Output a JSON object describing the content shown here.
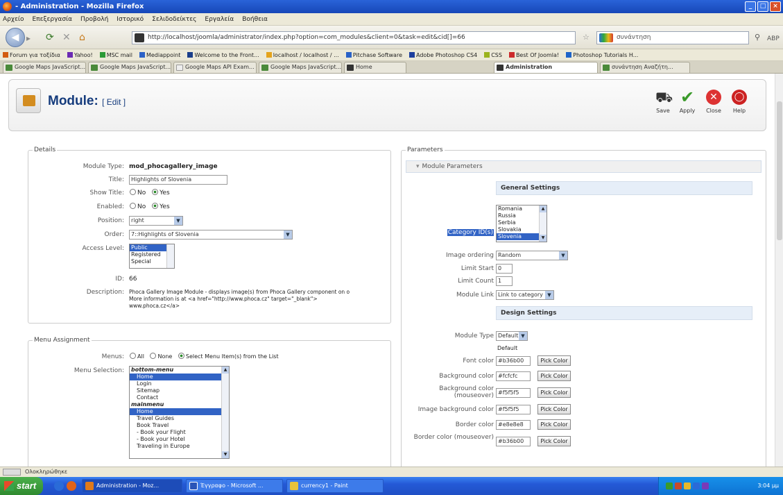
{
  "window": {
    "title": "- Administration - Mozilla Firefox"
  },
  "menubar": [
    "Αρχείο",
    "Επεξεργασία",
    "Προβολή",
    "Ιστορικό",
    "Σελιδοδείκτες",
    "Εργαλεία",
    "Βοήθεια"
  ],
  "nav": {
    "url": "http://localhost/joomla/administrator/index.php?option=com_modules&client=0&task=edit&cid[]=66",
    "search_placeholder": "συνάντηση"
  },
  "bookmarks": [
    "Forum για τοξίδια",
    "Yahoo!",
    "MSC mail",
    "Mediappoint",
    "Welcome to the Front...",
    "localhost / localhost / ...",
    "Pitchase Software",
    "Adobe Photoshop CS4",
    "CSS",
    "Best Of Joomla!",
    "Photoshop Tutorials H..."
  ],
  "tabs": [
    "Google Maps JavaScript...",
    "Google Maps JavaScript...",
    "Google Maps API Exam...",
    "Google Maps JavaScript...",
    "Home",
    "Administration",
    "συνάντηση Αναζήτη..."
  ],
  "page": {
    "title": "Module:",
    "subtitle": "[ Edit ]",
    "toolbar": {
      "save": "Save",
      "apply": "Apply",
      "close": "Close",
      "help": "Help"
    }
  },
  "details": {
    "legend": "Details",
    "module_type_label": "Module Type:",
    "module_type": "mod_phocagallery_image",
    "title_label": "Title:",
    "title_value": "Highlights of Slovenia",
    "show_title_label": "Show Title:",
    "no": "No",
    "yes": "Yes",
    "enabled_label": "Enabled:",
    "position_label": "Position:",
    "position_value": "right",
    "order_label": "Order:",
    "order_value": "7::Highlights of Slovenia",
    "access_label": "Access Level:",
    "access_options": [
      "Public",
      "Registered",
      "Special"
    ],
    "id_label": "ID:",
    "id_value": "66",
    "description_label": "Description:",
    "description_line1": "Phoca Gallery Image Module - displays image(s) from Phoca Gallery component on o",
    "description_line2": "More information is at <a href=\"http://www.phoca.cz\" target=\"_blank\">",
    "description_line3": "www.phoca.cz</a>"
  },
  "menu_assignment": {
    "legend": "Menu Assignment",
    "menus_label": "Menus:",
    "opt_all": "All",
    "opt_none": "None",
    "opt_select": "Select Menu Item(s) from the List",
    "selection_label": "Menu Selection:",
    "items": [
      {
        "text": "bottom-menu",
        "kind": "grp"
      },
      {
        "text": "Home",
        "kind": "sel"
      },
      {
        "text": "Login",
        "kind": "item"
      },
      {
        "text": "Sitemap",
        "kind": "item"
      },
      {
        "text": "Contact",
        "kind": "item"
      },
      {
        "text": "mainmenu",
        "kind": "grp"
      },
      {
        "text": "Home",
        "kind": "sel"
      },
      {
        "text": "Travel Guides",
        "kind": "item"
      },
      {
        "text": "Book Travel",
        "kind": "item"
      },
      {
        "text": "- Book your Flight",
        "kind": "item"
      },
      {
        "text": "- Book your Hotel",
        "kind": "item"
      },
      {
        "text": "Traveling in Europe",
        "kind": "item"
      }
    ]
  },
  "parameters": {
    "legend": "Parameters",
    "section_title": "Module Parameters",
    "general_settings": "General Settings",
    "category_label": "Category ID(s)",
    "categories": [
      "Romania",
      "Russia",
      "Serbia",
      "Slovakia",
      "Slovenia"
    ],
    "image_ordering_label": "Image ordering",
    "image_ordering_value": "Random",
    "limit_start_label": "Limit Start",
    "limit_start_value": "0",
    "limit_count_label": "Limit Count",
    "limit_count_value": "1",
    "module_link_label": "Module Link",
    "module_link_value": "Link to category",
    "design_settings": "Design Settings",
    "module_type_label": "Module Type",
    "module_type_value": "Default",
    "default_text": "Default",
    "font_color_label": "Font color",
    "font_color_value": "#b36b00",
    "bg_color_label": "Background color",
    "bg_color_value": "#fcfcfc",
    "bg_color_mo_label": "Background color (mouseover)",
    "bg_color_mo_value": "#f5f5f5",
    "img_bg_color_label": "Image background color",
    "img_bg_color_value": "#f5f5f5",
    "border_color_label": "Border color",
    "border_color_value": "#e8e8e8",
    "border_color_mo_label": "Border color (mouseover)",
    "border_color_mo_value": "#b36b00",
    "pick_color": "Pick Color"
  },
  "statusbar": {
    "text": "Ολοκληρώθηκε"
  },
  "taskbar": {
    "start": "start",
    "items": [
      "Administration - Moz...",
      "Έγγραφο - Microsoft ...",
      "currency1 - Paint"
    ],
    "clock": "3:04 μμ"
  },
  "colors": {
    "titlebar": "#1f54c8",
    "joomla_title": "#163c7d",
    "selection": "#3163c5",
    "section_header": "#e6eef8"
  }
}
